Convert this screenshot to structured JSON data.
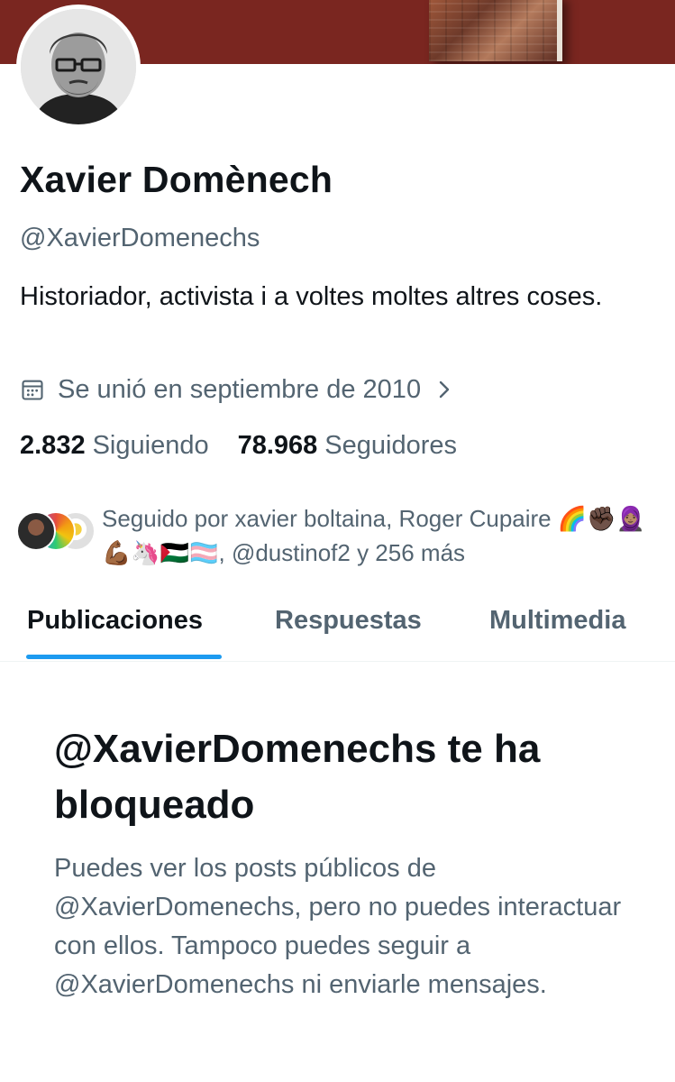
{
  "profile": {
    "name": "Xavier Domènech",
    "handle": "@XavierDomenechs",
    "bio": "Historiador, activista i a voltes moltes altres coses.",
    "joined": "Se unió en septiembre de 2010",
    "following_count": "2.832",
    "following_label": "Siguiendo",
    "followers_count": "78.968",
    "followers_label": "Seguidores",
    "followed_by": "Seguido por xavier boltaina, Roger Cupaire 🌈✊🏿🧕🏽💪🏾🦄🇵🇸🏳️‍⚧️, @dustinof2 y 256 más"
  },
  "tabs": [
    {
      "label": "Publicaciones",
      "active": true
    },
    {
      "label": "Respuestas",
      "active": false
    },
    {
      "label": "Multimedia",
      "active": false
    }
  ],
  "blocked": {
    "title": "@XavierDomenechs te ha bloqueado",
    "text": "Puedes ver los posts públicos de @XavierDomenechs, pero no puedes interactuar con ellos. Tampoco puedes seguir a @XavierDomenechs ni enviarle mensajes."
  },
  "colors": {
    "banner": "#7a2620",
    "accent": "#1d9bf0",
    "secondary_text": "#536471"
  },
  "icons": [
    "calendar-icon",
    "chevron-right-icon"
  ]
}
